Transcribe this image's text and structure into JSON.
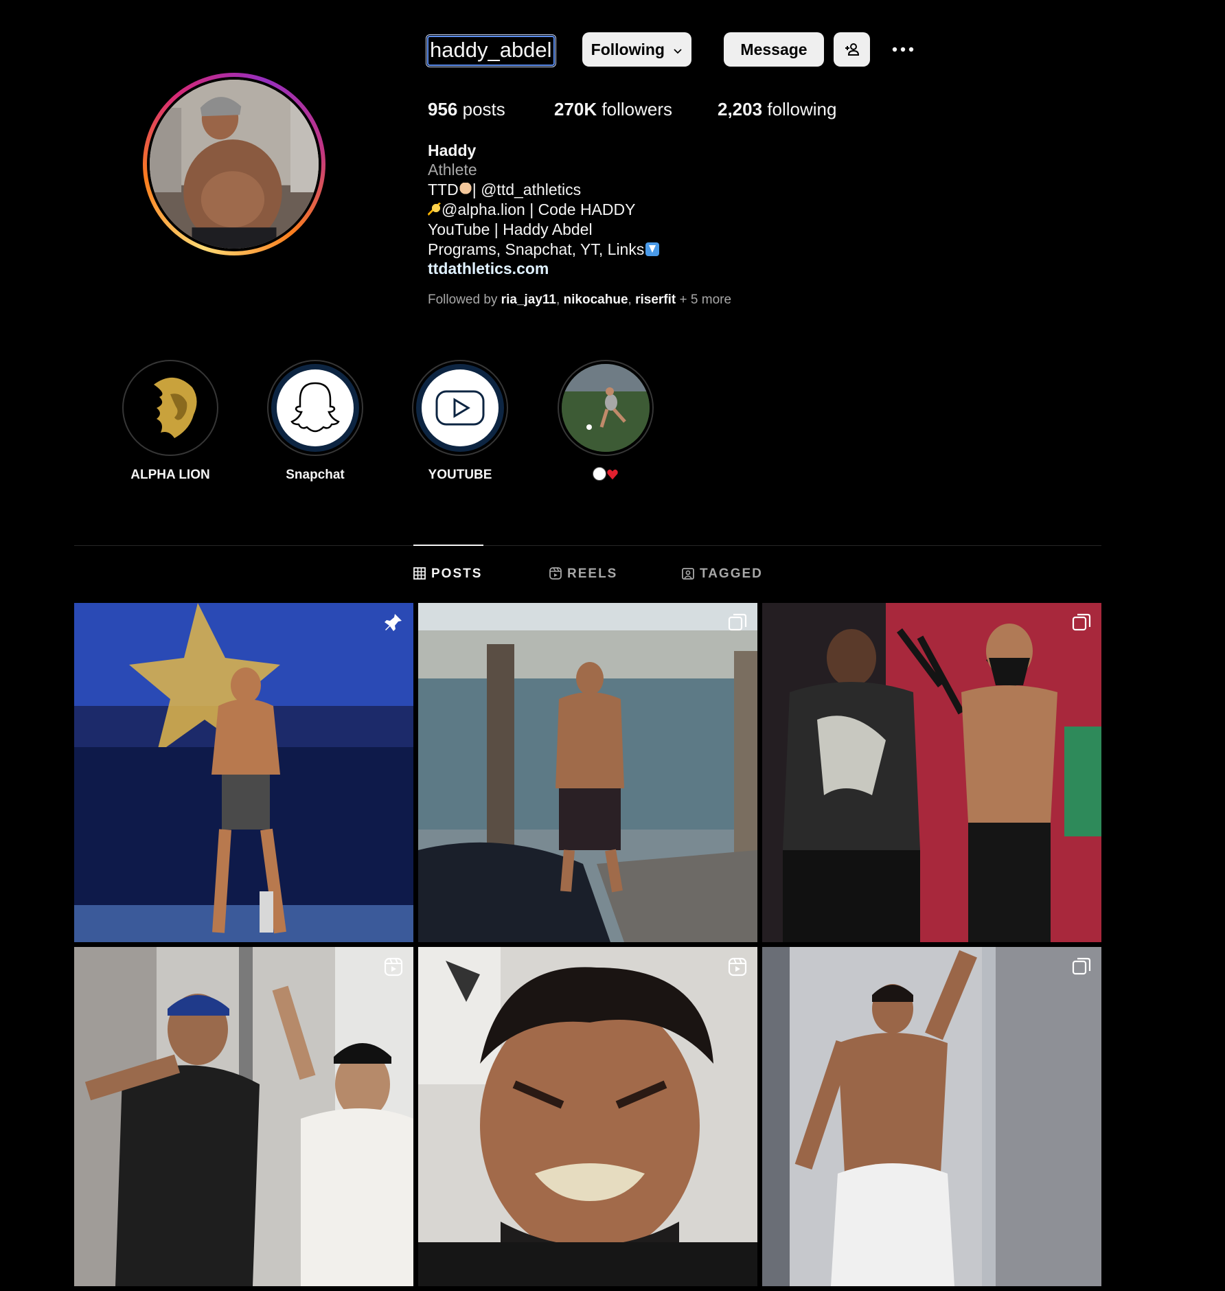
{
  "profile": {
    "username": "haddy_abdel",
    "buttons": {
      "following": "Following",
      "message": "Message"
    },
    "stats": {
      "posts_count": "956",
      "posts_label": "posts",
      "followers_count": "270K",
      "followers_label": "followers",
      "following_count": "2,203",
      "following_label": "following"
    },
    "bio": {
      "name": "Haddy",
      "category": "Athlete",
      "line1_prefix": "TTD",
      "line1_suffix": "| @ttd_athletics",
      "line2": "@alpha.lion | Code HADDY",
      "line3": "YouTube | Haddy Abdel",
      "line4": "Programs, Snapchat, YT, Links",
      "link": "ttdathletics.com"
    },
    "followed_by": {
      "prefix": "Followed by",
      "users": [
        "ria_jay11",
        "nikocahue",
        "riserfit"
      ],
      "more": "+ 5 more"
    }
  },
  "highlights": [
    {
      "label": "ALPHA LION",
      "icon": "lion-logo-icon"
    },
    {
      "label": "Snapchat",
      "icon": "snapchat-ghost-icon"
    },
    {
      "label": "YOUTUBE",
      "icon": "youtube-play-icon"
    },
    {
      "label": "",
      "icon": "soccer-heart-emoji"
    }
  ],
  "tabs": [
    {
      "label": "POSTS",
      "icon": "grid-icon",
      "active": true
    },
    {
      "label": "REELS",
      "icon": "reels-icon",
      "active": false
    },
    {
      "label": "TAGGED",
      "icon": "tagged-icon",
      "active": false
    }
  ],
  "posts": [
    {
      "badge": "pin-icon"
    },
    {
      "badge": "carousel-icon"
    },
    {
      "badge": "carousel-icon"
    },
    {
      "badge": "reel-icon"
    },
    {
      "badge": "reel-icon"
    },
    {
      "badge": "carousel-icon"
    }
  ],
  "colors": {
    "background": "#000000",
    "text": "#f5f5f5",
    "muted": "#a8a8a8",
    "button_bg": "#efefef",
    "link": "#e0f1ff",
    "divider": "#262626"
  }
}
